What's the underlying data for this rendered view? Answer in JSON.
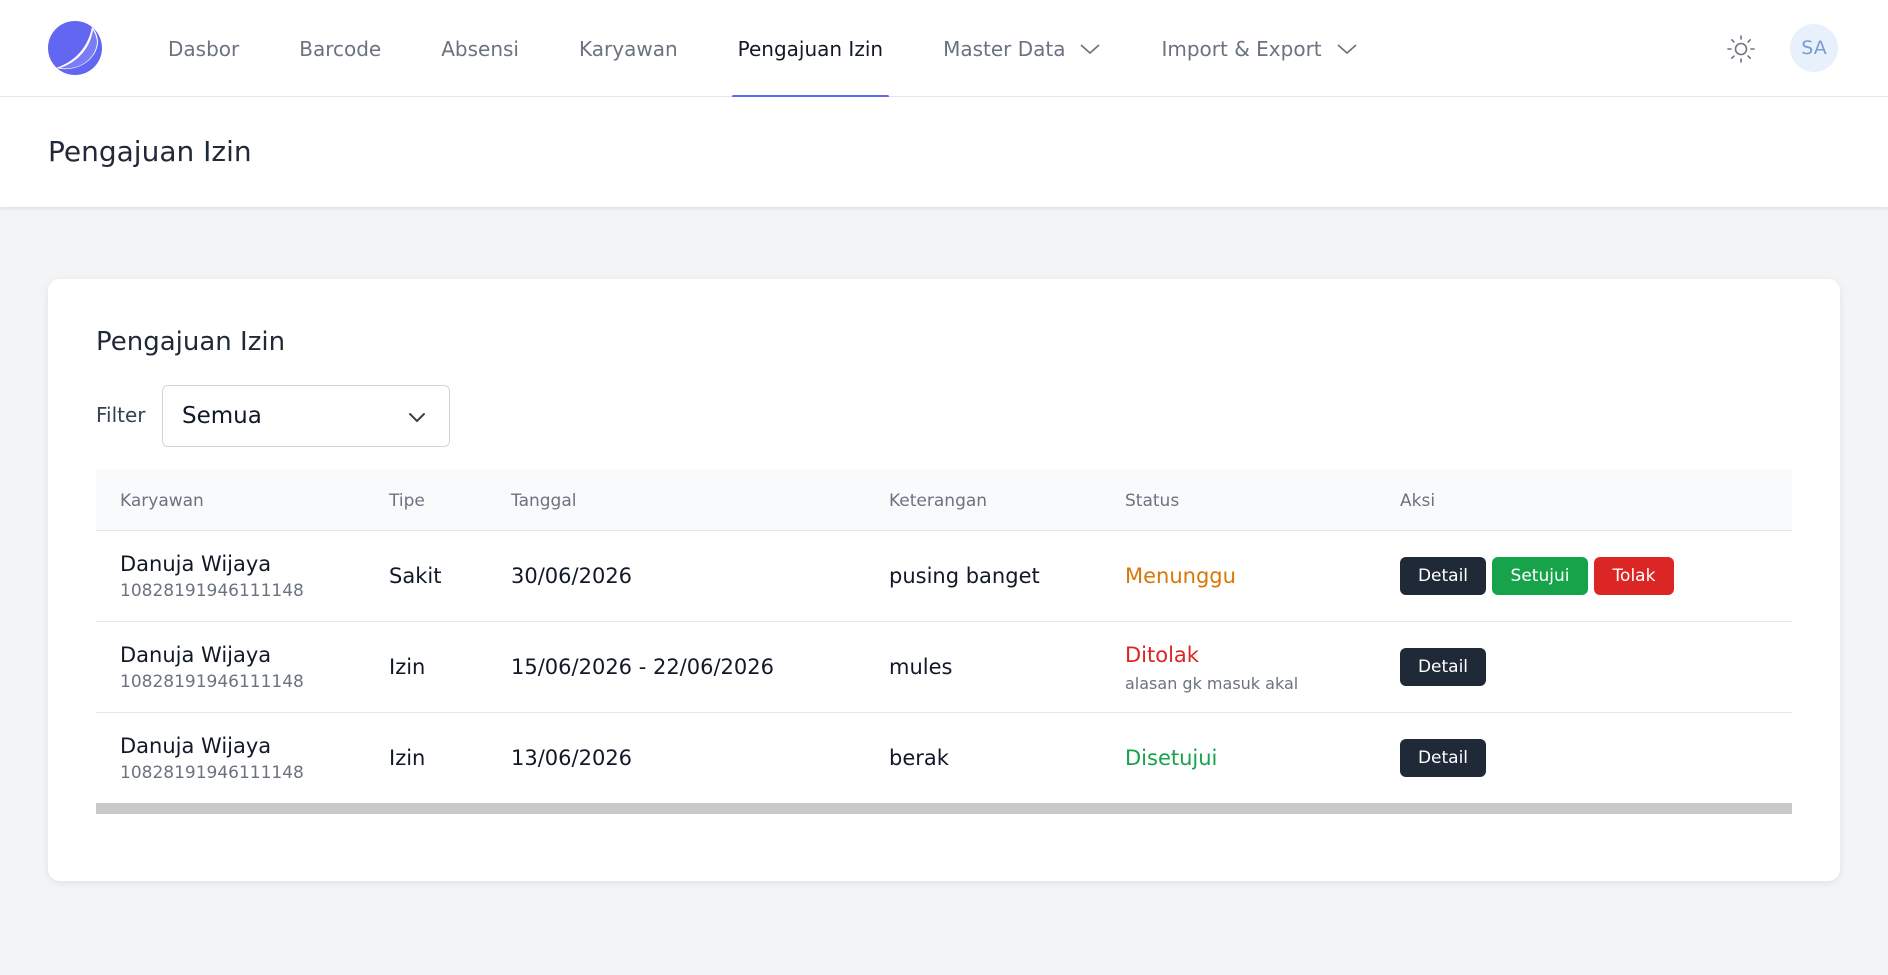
{
  "nav": {
    "items": [
      {
        "label": "Dasbor"
      },
      {
        "label": "Barcode"
      },
      {
        "label": "Absensi"
      },
      {
        "label": "Karyawan"
      },
      {
        "label": "Pengajuan Izin",
        "active": true
      },
      {
        "label": "Master Data",
        "dropdown": true
      },
      {
        "label": "Import & Export",
        "dropdown": true
      }
    ],
    "avatar_initials": "SA",
    "accent_color": "#6366f1"
  },
  "header": {
    "title": "Pengajuan Izin"
  },
  "card": {
    "title": "Pengajuan Izin",
    "filter_label": "Filter",
    "filter_value": "Semua"
  },
  "table": {
    "columns": [
      "Karyawan",
      "Tipe",
      "Tanggal",
      "Keterangan",
      "Status",
      "Aksi"
    ],
    "rows": [
      {
        "name": "Danuja Wijaya",
        "id": "10828191946111148",
        "type": "Sakit",
        "date": "30/06/2026",
        "note": "pusing banget",
        "status": "Menunggu",
        "status_note": "",
        "status_color": "#d97706"
      },
      {
        "name": "Danuja Wijaya",
        "id": "10828191946111148",
        "type": "Izin",
        "date": "15/06/2026 - 22/06/2026",
        "note": "mules",
        "status": "Ditolak",
        "status_note": "alasan gk masuk akal",
        "status_color": "#dc2626"
      },
      {
        "name": "Danuja Wijaya",
        "id": "10828191946111148",
        "type": "Izin",
        "date": "13/06/2026",
        "note": "berak",
        "status": "Disetujui",
        "status_note": "",
        "status_color": "#16a34a"
      }
    ],
    "actions": {
      "detail": "Detail",
      "approve": "Setujui",
      "reject": "Tolak"
    }
  }
}
